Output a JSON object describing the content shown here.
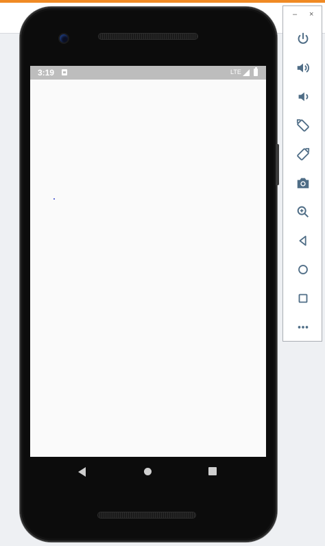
{
  "status_bar": {
    "time": "3:19",
    "network": "LTE"
  },
  "device_controls": {
    "minimize": "–",
    "close": "×",
    "tools": [
      {
        "name": "power",
        "icon": "power-icon"
      },
      {
        "name": "volume-up",
        "icon": "volume-up-icon"
      },
      {
        "name": "volume-down",
        "icon": "volume-down-icon"
      },
      {
        "name": "rotate-left",
        "icon": "rotate-left-icon"
      },
      {
        "name": "rotate-right",
        "icon": "rotate-right-icon"
      },
      {
        "name": "screenshot",
        "icon": "camera-icon"
      },
      {
        "name": "zoom",
        "icon": "zoom-icon"
      },
      {
        "name": "back",
        "icon": "back-icon"
      },
      {
        "name": "home",
        "icon": "home-icon"
      },
      {
        "name": "overview",
        "icon": "overview-icon"
      },
      {
        "name": "more",
        "icon": "more-icon"
      }
    ]
  },
  "colors": {
    "accent_bar": "#f08a24",
    "tool_icon": "#4f6d86",
    "statusbar": "#bdbdbd",
    "screen": "#fafafa"
  }
}
